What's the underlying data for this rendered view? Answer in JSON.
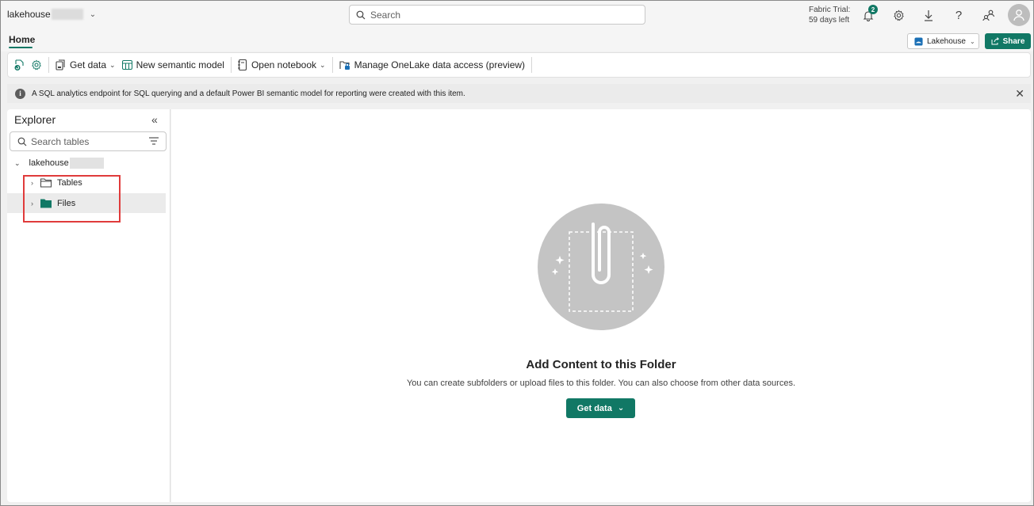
{
  "topbar": {
    "workspace_name": "lakehouse",
    "search_placeholder": "Search",
    "trial_line1": "Fabric Trial:",
    "trial_line2": "59 days left",
    "notification_count": "2"
  },
  "tabs": {
    "home_label": "Home"
  },
  "header_actions": {
    "item_type_label": "Lakehouse",
    "share_label": "Share"
  },
  "ribbon": {
    "get_data_label": "Get data",
    "new_semantic_model_label": "New semantic model",
    "open_notebook_label": "Open notebook",
    "manage_onelake_label": "Manage OneLake data access (preview)"
  },
  "infobar": {
    "message": "A SQL analytics endpoint for SQL querying and a default Power BI semantic model for reporting were created with this item."
  },
  "explorer": {
    "title": "Explorer",
    "search_placeholder": "Search tables",
    "root_label": "lakehouse",
    "items": [
      {
        "label": "Tables"
      },
      {
        "label": "Files"
      }
    ]
  },
  "empty_state": {
    "title": "Add Content to this Folder",
    "subtitle": "You can create subfolders or upload files to this folder. You can also choose from other data sources.",
    "button_label": "Get data"
  },
  "colors": {
    "accent": "#117865",
    "highlight": "#e03b3b"
  }
}
